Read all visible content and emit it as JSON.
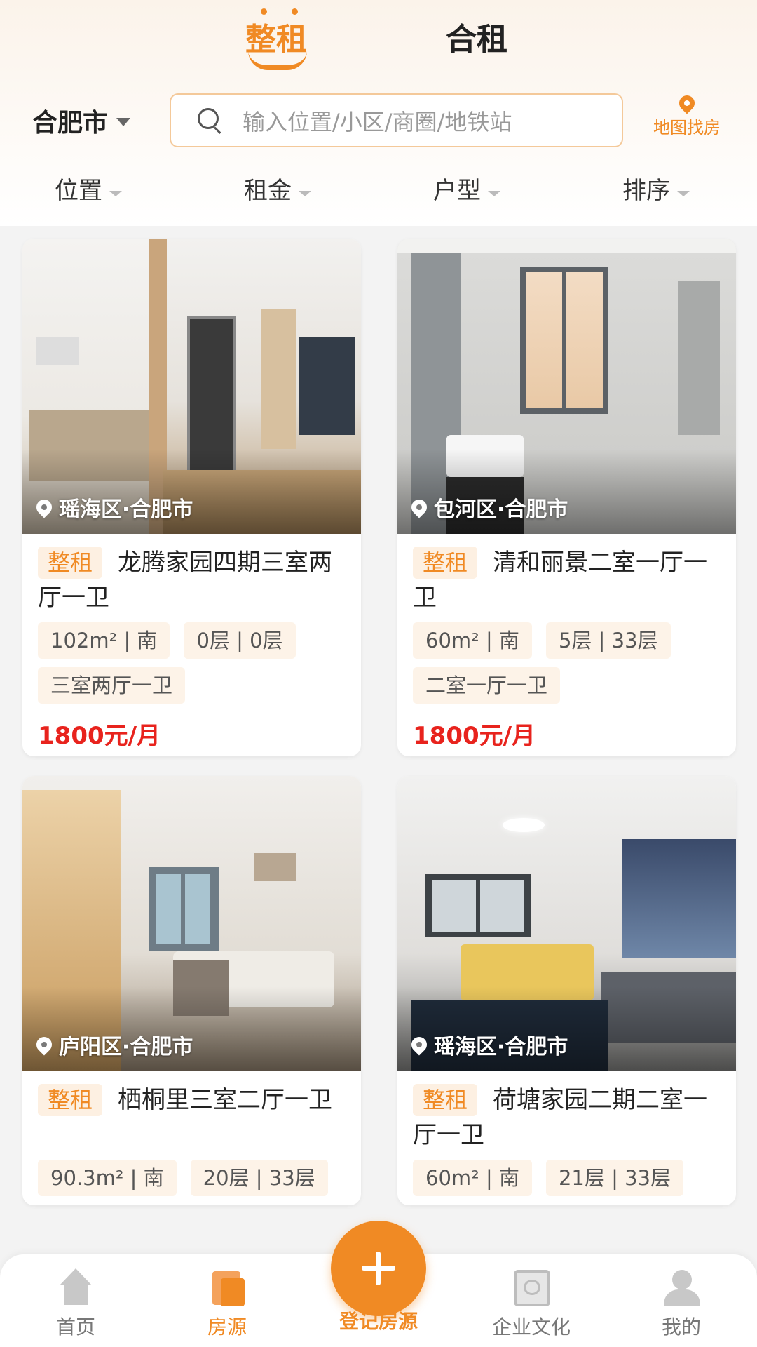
{
  "tabs": {
    "active": "整租",
    "inactive": "合租"
  },
  "city": "合肥市",
  "search": {
    "placeholder": "输入位置/小区/商圈/地铁站"
  },
  "map_button": "地图找房",
  "filters": [
    "位置",
    "租金",
    "户型",
    "排序"
  ],
  "listings": [
    {
      "location": "瑶海区·合肥市",
      "type_badge": "整租",
      "title": "龙腾家园四期三室两厅一卫",
      "area_dir": "102m² | 南",
      "floor": "0层 | 0层",
      "layout": "三室两厅一卫",
      "price": "1800元/月"
    },
    {
      "location": "包河区·合肥市",
      "type_badge": "整租",
      "title": "清和丽景二室一厅一卫",
      "area_dir": "60m² | 南",
      "floor": "5层 | 33层",
      "layout": "二室一厅一卫",
      "price": "1800元/月"
    },
    {
      "location": "庐阳区·合肥市",
      "type_badge": "整租",
      "title": "栖桐里三室二厅一卫",
      "area_dir": "90.3m² | 南",
      "floor": "20层 | 33层"
    },
    {
      "location": "瑶海区·合肥市",
      "type_badge": "整租",
      "title": "荷塘家园二期二室一厅一卫",
      "area_dir": "60m² | 南",
      "floor": "21层 | 33层"
    }
  ],
  "bottom_nav": {
    "home": "首页",
    "listings": "房源",
    "register": "登记房源",
    "culture": "企业文化",
    "mine": "我的"
  },
  "colors": {
    "accent": "#f08a24",
    "price": "#e8231d"
  }
}
